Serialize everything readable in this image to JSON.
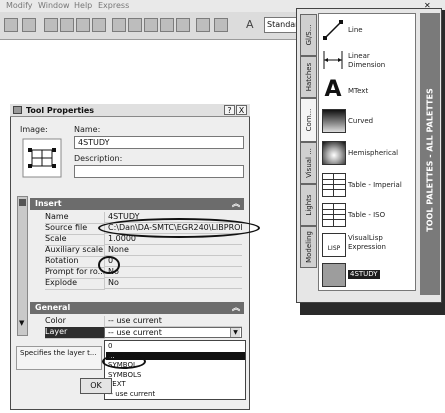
{
  "menubar": {
    "items": [
      "Modify",
      "Window",
      "Help",
      "Express"
    ]
  },
  "toolbar": {
    "text_style_value": "Standard"
  },
  "palette": {
    "title": "TOOL PALETTES - ALL PALETTES",
    "tabs": [
      "Hatches",
      "Com...",
      "Visual ...",
      "Lights",
      "Modeling",
      "Gl/S..."
    ],
    "items": [
      {
        "label": "Line",
        "icon": "line-icon"
      },
      {
        "label": "Linear\nDimension",
        "icon": "linear-dimension-icon"
      },
      {
        "label": "MText",
        "icon": "mtext-icon"
      },
      {
        "label": "Curved",
        "icon": "curved-gradient-icon"
      },
      {
        "label": "Hemispherical",
        "icon": "hemispherical-gradient-icon"
      },
      {
        "label": "Table - Imperial",
        "icon": "table-icon"
      },
      {
        "label": "Table - ISO",
        "icon": "table-icon"
      },
      {
        "label": "VisualLisp\nExpression",
        "icon": "visuallisp-icon"
      },
      {
        "label": "4STUDY",
        "icon": "block-icon"
      }
    ],
    "mtext_glyph": "A",
    "lisp_glyph": "LISP"
  },
  "dialog": {
    "title": "Tool Properties",
    "image_label": "Image:",
    "name_label": "Name:",
    "name_value": "4STUDY",
    "description_label": "Description:",
    "description_value": "",
    "sections": {
      "insert": {
        "title": "Insert",
        "rows": [
          {
            "key": "Name",
            "value": "4STUDY"
          },
          {
            "key": "Source file",
            "value": "C:\\Dan\\DA-SMTC\\EGR240\\LIBPROB..."
          },
          {
            "key": "Scale",
            "value": "1.0000"
          },
          {
            "key": "Auxiliary scale",
            "value": "None"
          },
          {
            "key": "Rotation",
            "value": "0"
          },
          {
            "key": "Prompt for ro...",
            "value": "No"
          },
          {
            "key": "Explode",
            "value": "No"
          }
        ]
      },
      "general": {
        "title": "General",
        "rows": [
          {
            "key": "Color",
            "value": "-- use current"
          },
          {
            "key": "Layer",
            "value": "-- use current"
          }
        ]
      }
    },
    "layer_options": [
      "0",
      "...",
      "SYMBOL",
      "SYMBOLS",
      "TEXT",
      "-- use current"
    ],
    "layer_highlighted_index": 1,
    "description_panel_text": "Specifies the layer t...",
    "ok_label": "OK",
    "window_buttons": [
      "?",
      "X"
    ]
  }
}
